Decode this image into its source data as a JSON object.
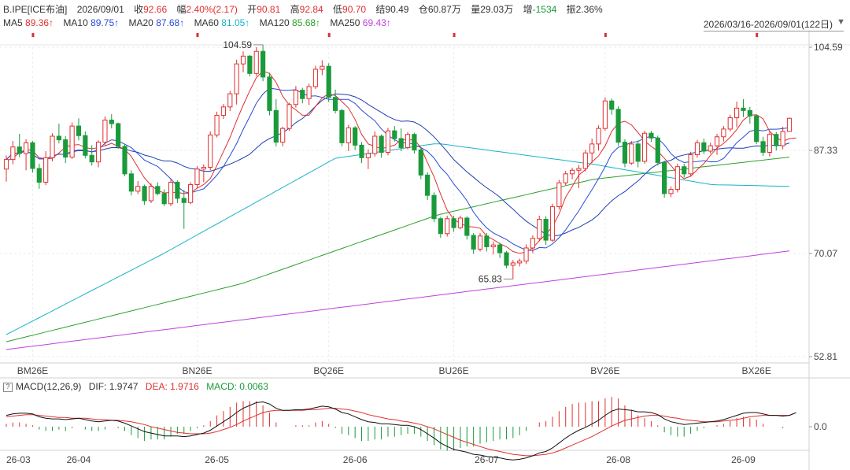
{
  "header": {
    "symbol": "B.IPE[ICE布油]",
    "date": "2026/09/01",
    "close_label": "收",
    "close": "92.66",
    "change_label": "幅",
    "change": "2.40%(2.17)",
    "open_label": "开",
    "open": "90.81",
    "high_label": "高",
    "high": "92.84",
    "low_label": "低",
    "low": "90.70",
    "settle_label": "结",
    "settle": "90.49",
    "oi_label": "仓",
    "oi": "60.87万",
    "vol_label": "量",
    "vol": "29.03万",
    "inc_label": "增",
    "inc": "-1534",
    "amp_label": "振",
    "amp": "2.36%"
  },
  "ma": [
    {
      "label": "MA5",
      "value": "89.36↑",
      "color": "#e03030"
    },
    {
      "label": "MA10",
      "value": "89.75↑",
      "color": "#2a4bd7"
    },
    {
      "label": "MA20",
      "value": "87.68↑",
      "color": "#2a4bd7"
    },
    {
      "label": "MA60",
      "value": "81.05↑",
      "color": "#17b3c9"
    },
    {
      "label": "MA120",
      "value": "85.68↑",
      "color": "#2ca02c"
    },
    {
      "label": "MA250",
      "value": "69.43↑",
      "color": "#c040e0"
    }
  ],
  "range": "2026/03/16-2026/09/01(122日)",
  "macd_header": {
    "toggle": "?",
    "name": "MACD(12,26,9)",
    "dif_label": "DIF:",
    "dif": "1.9747",
    "dea_label": "DEA:",
    "dea": "1.9716",
    "macd_label": "MACD:",
    "macd": "0.0063"
  },
  "colors": {
    "up": "#e03030",
    "down": "#1a9a3a",
    "dif": "#111111",
    "dea": "#e03030",
    "ma5": "#e03030",
    "ma10": "#2a4bd7",
    "ma20": "#1f3fb0",
    "ma60": "#17b3c9",
    "ma120": "#2ca02c",
    "ma250": "#c040e0"
  },
  "chart_data": {
    "type": "candlestick",
    "price_axis": {
      "ticks": [
        "104.59",
        "87.33",
        "70.07",
        "52.81"
      ],
      "ylim": [
        52.81,
        104.59
      ]
    },
    "macd_axis": {
      "ticks": [
        "0.0"
      ]
    },
    "contract_labels": [
      "BM26E",
      "BN26E",
      "BQ26E",
      "BU26E",
      "BV26E",
      "BX26E"
    ],
    "month_labels": [
      "26-03",
      "26-04",
      "26-05",
      "26-06",
      "26-07",
      "26-08",
      "26-09"
    ],
    "annotations": [
      {
        "text": "104.59",
        "type": "max"
      },
      {
        "text": "65.83",
        "type": "min"
      }
    ],
    "candles": [
      [
        84.2,
        86.5,
        82.1,
        85.8
      ],
      [
        85.8,
        88.9,
        85.0,
        87.9
      ],
      [
        87.9,
        90.1,
        86.2,
        86.8
      ],
      [
        86.8,
        89.2,
        84.0,
        88.6
      ],
      [
        88.6,
        88.9,
        83.6,
        84.3
      ],
      [
        84.3,
        85.1,
        80.9,
        82.0
      ],
      [
        82.0,
        87.2,
        81.5,
        86.1
      ],
      [
        86.1,
        90.2,
        85.5,
        89.7
      ],
      [
        89.7,
        91.8,
        88.5,
        89.1
      ],
      [
        89.1,
        89.7,
        85.2,
        86.2
      ],
      [
        86.2,
        92.0,
        85.9,
        91.4
      ],
      [
        91.4,
        92.7,
        89.0,
        89.8
      ],
      [
        89.8,
        90.5,
        86.0,
        86.5
      ],
      [
        86.5,
        88.2,
        84.8,
        85.4
      ],
      [
        85.4,
        89.0,
        84.5,
        88.7
      ],
      [
        88.7,
        93.0,
        88.0,
        92.4
      ],
      [
        92.4,
        93.4,
        91.0,
        91.8
      ],
      [
        91.8,
        92.0,
        87.6,
        88.0
      ],
      [
        88.0,
        88.4,
        83.0,
        83.4
      ],
      [
        83.4,
        84.0,
        79.8,
        80.5
      ],
      [
        80.5,
        82.2,
        80.0,
        81.3
      ],
      [
        81.3,
        81.6,
        78.2,
        78.9
      ],
      [
        78.9,
        81.8,
        78.5,
        81.3
      ],
      [
        81.3,
        82.0,
        79.8,
        80.1
      ],
      [
        80.1,
        80.8,
        78.0,
        78.4
      ],
      [
        78.4,
        82.5,
        78.0,
        82.0
      ],
      [
        82.0,
        82.3,
        78.5,
        79.3
      ],
      [
        79.3,
        80.7,
        74.2,
        78.6
      ],
      [
        78.6,
        82.0,
        78.3,
        81.6
      ],
      [
        81.6,
        84.7,
        81.0,
        84.2
      ],
      [
        84.2,
        85.0,
        82.0,
        84.5
      ],
      [
        84.5,
        90.5,
        84.0,
        89.9
      ],
      [
        89.9,
        93.8,
        89.5,
        93.2
      ],
      [
        93.2,
        95.1,
        92.6,
        94.6
      ],
      [
        94.6,
        97.3,
        93.9,
        96.8
      ],
      [
        96.8,
        102.5,
        95.0,
        101.8
      ],
      [
        101.8,
        103.9,
        100.4,
        103.1
      ],
      [
        103.1,
        103.3,
        99.7,
        100.2
      ],
      [
        100.2,
        104.6,
        99.8,
        103.9
      ],
      [
        103.9,
        105.0,
        98.9,
        99.6
      ],
      [
        99.6,
        100.3,
        93.2,
        94.0
      ],
      [
        94.0,
        95.9,
        88.0,
        88.7
      ],
      [
        88.7,
        91.3,
        88.0,
        91.0
      ],
      [
        91.0,
        95.3,
        90.6,
        95.0
      ],
      [
        95.0,
        98.1,
        94.5,
        97.4
      ],
      [
        97.4,
        97.8,
        95.2,
        96.0
      ],
      [
        96.0,
        98.5,
        94.9,
        98.0
      ],
      [
        98.0,
        101.5,
        97.6,
        100.9
      ],
      [
        100.9,
        102.4,
        99.9,
        101.4
      ],
      [
        101.4,
        101.9,
        95.4,
        96.2
      ],
      [
        96.2,
        97.5,
        93.5,
        94.0
      ],
      [
        94.0,
        94.3,
        88.0,
        88.6
      ],
      [
        88.6,
        91.6,
        87.2,
        91.1
      ],
      [
        91.1,
        91.4,
        87.4,
        88.2
      ],
      [
        88.2,
        88.7,
        85.2,
        86.1
      ],
      [
        86.1,
        87.5,
        84.2,
        86.8
      ],
      [
        86.8,
        90.5,
        86.3,
        89.7
      ],
      [
        89.7,
        90.0,
        86.1,
        87.0
      ],
      [
        87.0,
        91.1,
        86.5,
        90.6
      ],
      [
        90.6,
        91.4,
        88.8,
        89.3
      ],
      [
        89.3,
        91.0,
        87.2,
        87.8
      ],
      [
        87.8,
        90.4,
        87.5,
        90.0
      ],
      [
        90.0,
        90.3,
        86.8,
        87.4
      ],
      [
        87.4,
        87.8,
        82.5,
        83.2
      ],
      [
        83.2,
        83.7,
        79.0,
        79.8
      ],
      [
        79.8,
        80.3,
        75.3,
        75.9
      ],
      [
        75.9,
        76.2,
        72.7,
        73.4
      ],
      [
        73.4,
        76.4,
        72.9,
        75.9
      ],
      [
        75.9,
        76.4,
        73.7,
        74.4
      ],
      [
        74.4,
        76.4,
        74.1,
        76.0
      ],
      [
        76.0,
        76.3,
        72.4,
        73.1
      ],
      [
        73.1,
        73.5,
        70.0,
        70.8
      ],
      [
        70.8,
        73.5,
        70.4,
        73.0
      ],
      [
        73.0,
        73.5,
        70.4,
        71.2
      ],
      [
        71.2,
        72.1,
        69.9,
        71.5
      ],
      [
        71.5,
        71.9,
        69.3,
        70.2
      ],
      [
        70.2,
        70.5,
        67.6,
        68.1
      ],
      [
        68.1,
        69.0,
        65.8,
        68.5
      ],
      [
        68.5,
        69.2,
        67.9,
        68.8
      ],
      [
        68.8,
        71.6,
        68.3,
        71.0
      ],
      [
        71.0,
        73.1,
        70.1,
        72.6
      ],
      [
        72.6,
        76.4,
        72.1,
        75.8
      ],
      [
        75.8,
        76.3,
        71.5,
        72.3
      ],
      [
        72.3,
        78.4,
        72.0,
        77.9
      ],
      [
        77.9,
        82.4,
        77.4,
        81.9
      ],
      [
        81.9,
        83.9,
        81.5,
        83.4
      ],
      [
        83.4,
        84.4,
        82.5,
        84.0
      ],
      [
        84.0,
        84.9,
        81.0,
        84.3
      ],
      [
        84.3,
        87.4,
        83.8,
        86.9
      ],
      [
        86.9,
        89.3,
        85.2,
        88.4
      ],
      [
        88.4,
        91.5,
        87.3,
        91.0
      ],
      [
        91.0,
        96.2,
        90.6,
        95.6
      ],
      [
        95.6,
        96.0,
        93.3,
        94.2
      ],
      [
        94.2,
        94.7,
        88.1,
        88.7
      ],
      [
        88.7,
        89.2,
        84.5,
        85.2
      ],
      [
        85.2,
        88.9,
        84.9,
        88.4
      ],
      [
        88.4,
        89.0,
        84.5,
        85.5
      ],
      [
        85.5,
        90.6,
        85.1,
        90.2
      ],
      [
        90.2,
        90.6,
        88.7,
        89.4
      ],
      [
        89.4,
        89.8,
        84.8,
        85.3
      ],
      [
        85.3,
        85.6,
        79.4,
        80.1
      ],
      [
        80.1,
        81.3,
        79.5,
        80.8
      ],
      [
        80.8,
        85.1,
        80.3,
        84.6
      ],
      [
        84.6,
        85.1,
        82.8,
        83.4
      ],
      [
        83.4,
        87.1,
        83.0,
        86.6
      ],
      [
        86.6,
        89.1,
        86.1,
        88.6
      ],
      [
        88.6,
        89.3,
        86.7,
        87.2
      ],
      [
        87.2,
        88.6,
        86.8,
        88.1
      ],
      [
        88.1,
        90.1,
        86.6,
        89.6
      ],
      [
        89.6,
        91.4,
        88.8,
        90.9
      ],
      [
        90.9,
        93.3,
        90.5,
        92.8
      ],
      [
        92.8,
        95.5,
        91.2,
        94.4
      ],
      [
        94.4,
        95.9,
        92.9,
        94.0
      ],
      [
        94.0,
        94.6,
        91.8,
        93.1
      ],
      [
        93.1,
        93.3,
        88.4,
        88.8
      ],
      [
        88.8,
        89.6,
        86.4,
        87.0
      ],
      [
        87.0,
        90.5,
        86.3,
        90.0
      ],
      [
        90.0,
        90.4,
        87.3,
        88.1
      ],
      [
        88.1,
        91.3,
        87.5,
        90.5
      ],
      [
        90.5,
        92.8,
        90.7,
        92.7
      ]
    ],
    "ma_series": {
      "ma5": [
        85.5,
        86.1,
        86.9,
        87.5,
        87.3,
        86.1,
        85.9,
        86.0,
        86.9,
        87.9,
        88.2,
        88.3,
        87.8,
        87.6,
        87.8,
        88.1,
        88.5,
        88.0,
        87.5,
        86.3,
        84.5,
        82.7,
        81.5,
        80.6,
        80.2,
        80.3,
        80.3,
        80.1,
        80.2,
        81.0,
        81.6,
        82.6,
        84.8,
        87.1,
        89.5,
        92.3,
        94.9,
        97.3,
        99.5,
        100.6,
        100.2,
        98.7,
        96.4,
        94.9,
        94.1,
        93.2,
        93.2,
        94.7,
        96.1,
        96.8,
        96.5,
        95.5,
        94.4,
        92.5,
        90.0,
        88.4,
        88.0,
        87.6,
        87.9,
        88.2,
        89.1,
        89.1,
        89.1,
        87.8,
        85.3,
        82.9,
        80.0,
        77.3,
        75.8,
        75.1,
        74.6,
        74.5,
        74.3,
        73.0,
        72.4,
        71.7,
        71.2,
        70.4,
        70.1,
        70.3,
        71.0,
        72.2,
        73.3,
        74.6,
        76.7,
        79.5,
        81.3,
        83.2,
        84.1,
        85.4,
        86.4,
        88.1,
        90.5,
        91.9,
        92.2,
        91.6,
        90.3,
        88.9,
        88.0,
        87.2,
        86.0,
        84.8,
        83.4,
        82.6,
        83.0,
        84.1,
        85.1,
        86.5,
        87.7,
        88.5,
        89.5,
        90.8,
        92.4,
        93.2,
        93.3,
        92.6,
        90.5,
        89.5,
        88.8,
        89.3,
        89.4
      ]
    },
    "macd": {
      "dif": [
        1.6,
        1.8,
        1.9,
        1.9,
        1.8,
        1.4,
        1.2,
        1.1,
        1.1,
        1.0,
        1.1,
        1.2,
        1.0,
        0.8,
        0.7,
        0.8,
        0.9,
        0.8,
        0.5,
        0.1,
        -0.3,
        -0.7,
        -0.9,
        -1.1,
        -1.3,
        -1.3,
        -1.3,
        -1.4,
        -1.3,
        -1.1,
        -0.9,
        -0.5,
        0.1,
        0.7,
        1.3,
        2.0,
        2.6,
        3.0,
        3.4,
        3.5,
        3.2,
        2.6,
        2.3,
        2.3,
        2.4,
        2.4,
        2.5,
        2.7,
        2.9,
        2.8,
        2.5,
        2.0,
        1.8,
        1.4,
        1.0,
        0.7,
        0.6,
        0.4,
        0.4,
        0.3,
        0.2,
        0.2,
        0.0,
        -0.4,
        -1.0,
        -1.6,
        -2.3,
        -2.8,
        -3.2,
        -3.4,
        -3.6,
        -3.9,
        -4.0,
        -4.2,
        -4.3,
        -4.4,
        -4.6,
        -4.7,
        -4.6,
        -4.4,
        -4.1,
        -3.7,
        -3.5,
        -3.0,
        -2.3,
        -1.6,
        -1.0,
        -0.5,
        -0.1,
        0.4,
        0.9,
        1.6,
        2.2,
        2.5,
        2.4,
        2.3,
        2.1,
        2.1,
        2.0,
        1.7,
        1.1,
        0.7,
        0.5,
        0.3,
        0.4,
        0.5,
        0.6,
        0.7,
        0.8,
        1.0,
        1.3,
        1.6,
        1.9,
        2.0,
        2.0,
        1.8,
        1.6,
        1.6,
        1.5,
        1.6,
        1.9747
      ],
      "dea": [
        1.4,
        1.5,
        1.6,
        1.7,
        1.7,
        1.6,
        1.5,
        1.4,
        1.3,
        1.3,
        1.2,
        1.2,
        1.2,
        1.1,
        1.0,
        1.0,
        0.9,
        0.9,
        0.8,
        0.7,
        0.5,
        0.3,
        0.0,
        -0.2,
        -0.4,
        -0.6,
        -0.8,
        -0.9,
        -1.0,
        -1.0,
        -1.0,
        -0.9,
        -0.7,
        -0.4,
        -0.1,
        0.3,
        0.8,
        1.2,
        1.6,
        2.0,
        2.2,
        2.3,
        2.3,
        2.3,
        2.3,
        2.3,
        2.4,
        2.4,
        2.5,
        2.6,
        2.6,
        2.5,
        2.4,
        2.2,
        2.0,
        1.7,
        1.5,
        1.3,
        1.1,
        1.0,
        0.8,
        0.7,
        0.5,
        0.3,
        0.0,
        -0.3,
        -0.7,
        -1.1,
        -1.5,
        -1.9,
        -2.2,
        -2.5,
        -2.8,
        -3.1,
        -3.3,
        -3.5,
        -3.7,
        -3.9,
        -4.0,
        -4.1,
        -4.1,
        -4.0,
        -3.9,
        -3.7,
        -3.4,
        -3.0,
        -2.6,
        -2.2,
        -1.8,
        -1.4,
        -0.9,
        -0.4,
        0.1,
        0.5,
        0.9,
        1.1,
        1.3,
        1.5,
        1.6,
        1.6,
        1.5,
        1.3,
        1.2,
        1.0,
        0.9,
        0.8,
        0.7,
        0.7,
        0.7,
        0.8,
        0.9,
        1.0,
        1.2,
        1.4,
        1.5,
        1.6,
        1.6,
        1.6,
        1.6,
        1.6,
        1.9716
      ],
      "macd": [
        0.4,
        0.6,
        0.6,
        0.4,
        0.2,
        -0.4,
        -0.6,
        -0.6,
        -0.4,
        -0.6,
        -0.2,
        0.0,
        -0.4,
        -0.6,
        -0.6,
        -0.4,
        0.0,
        -0.2,
        -0.6,
        -1.2,
        -1.6,
        -2.0,
        -1.8,
        -1.8,
        -1.8,
        -1.4,
        -1.0,
        -1.0,
        -0.6,
        -0.2,
        0.2,
        0.8,
        1.6,
        2.2,
        2.8,
        3.4,
        3.6,
        3.6,
        3.6,
        3.0,
        2.0,
        0.6,
        0.0,
        0.0,
        0.2,
        0.2,
        0.2,
        0.6,
        0.8,
        0.4,
        -0.2,
        -1.0,
        -1.2,
        -1.6,
        -2.0,
        -2.0,
        -1.8,
        -1.8,
        -1.4,
        -1.4,
        -1.2,
        -1.0,
        -1.0,
        -1.4,
        -2.0,
        -2.6,
        -3.2,
        -3.4,
        -3.4,
        -3.0,
        -2.8,
        -2.8,
        -2.4,
        -2.2,
        -2.0,
        -1.8,
        -1.8,
        -1.6,
        -1.2,
        -0.6,
        0.0,
        0.6,
        0.8,
        1.4,
        2.2,
        2.8,
        3.2,
        3.4,
        3.4,
        3.6,
        3.6,
        4.0,
        4.2,
        4.0,
        3.0,
        2.4,
        1.6,
        1.2,
        0.8,
        0.2,
        -0.8,
        -1.2,
        -1.4,
        -1.4,
        -1.0,
        -0.6,
        -0.2,
        0.0,
        0.2,
        0.4,
        0.8,
        1.2,
        1.4,
        1.2,
        1.0,
        0.4,
        0.0,
        0.0,
        -0.2,
        0.0,
        0.0063
      ]
    }
  }
}
